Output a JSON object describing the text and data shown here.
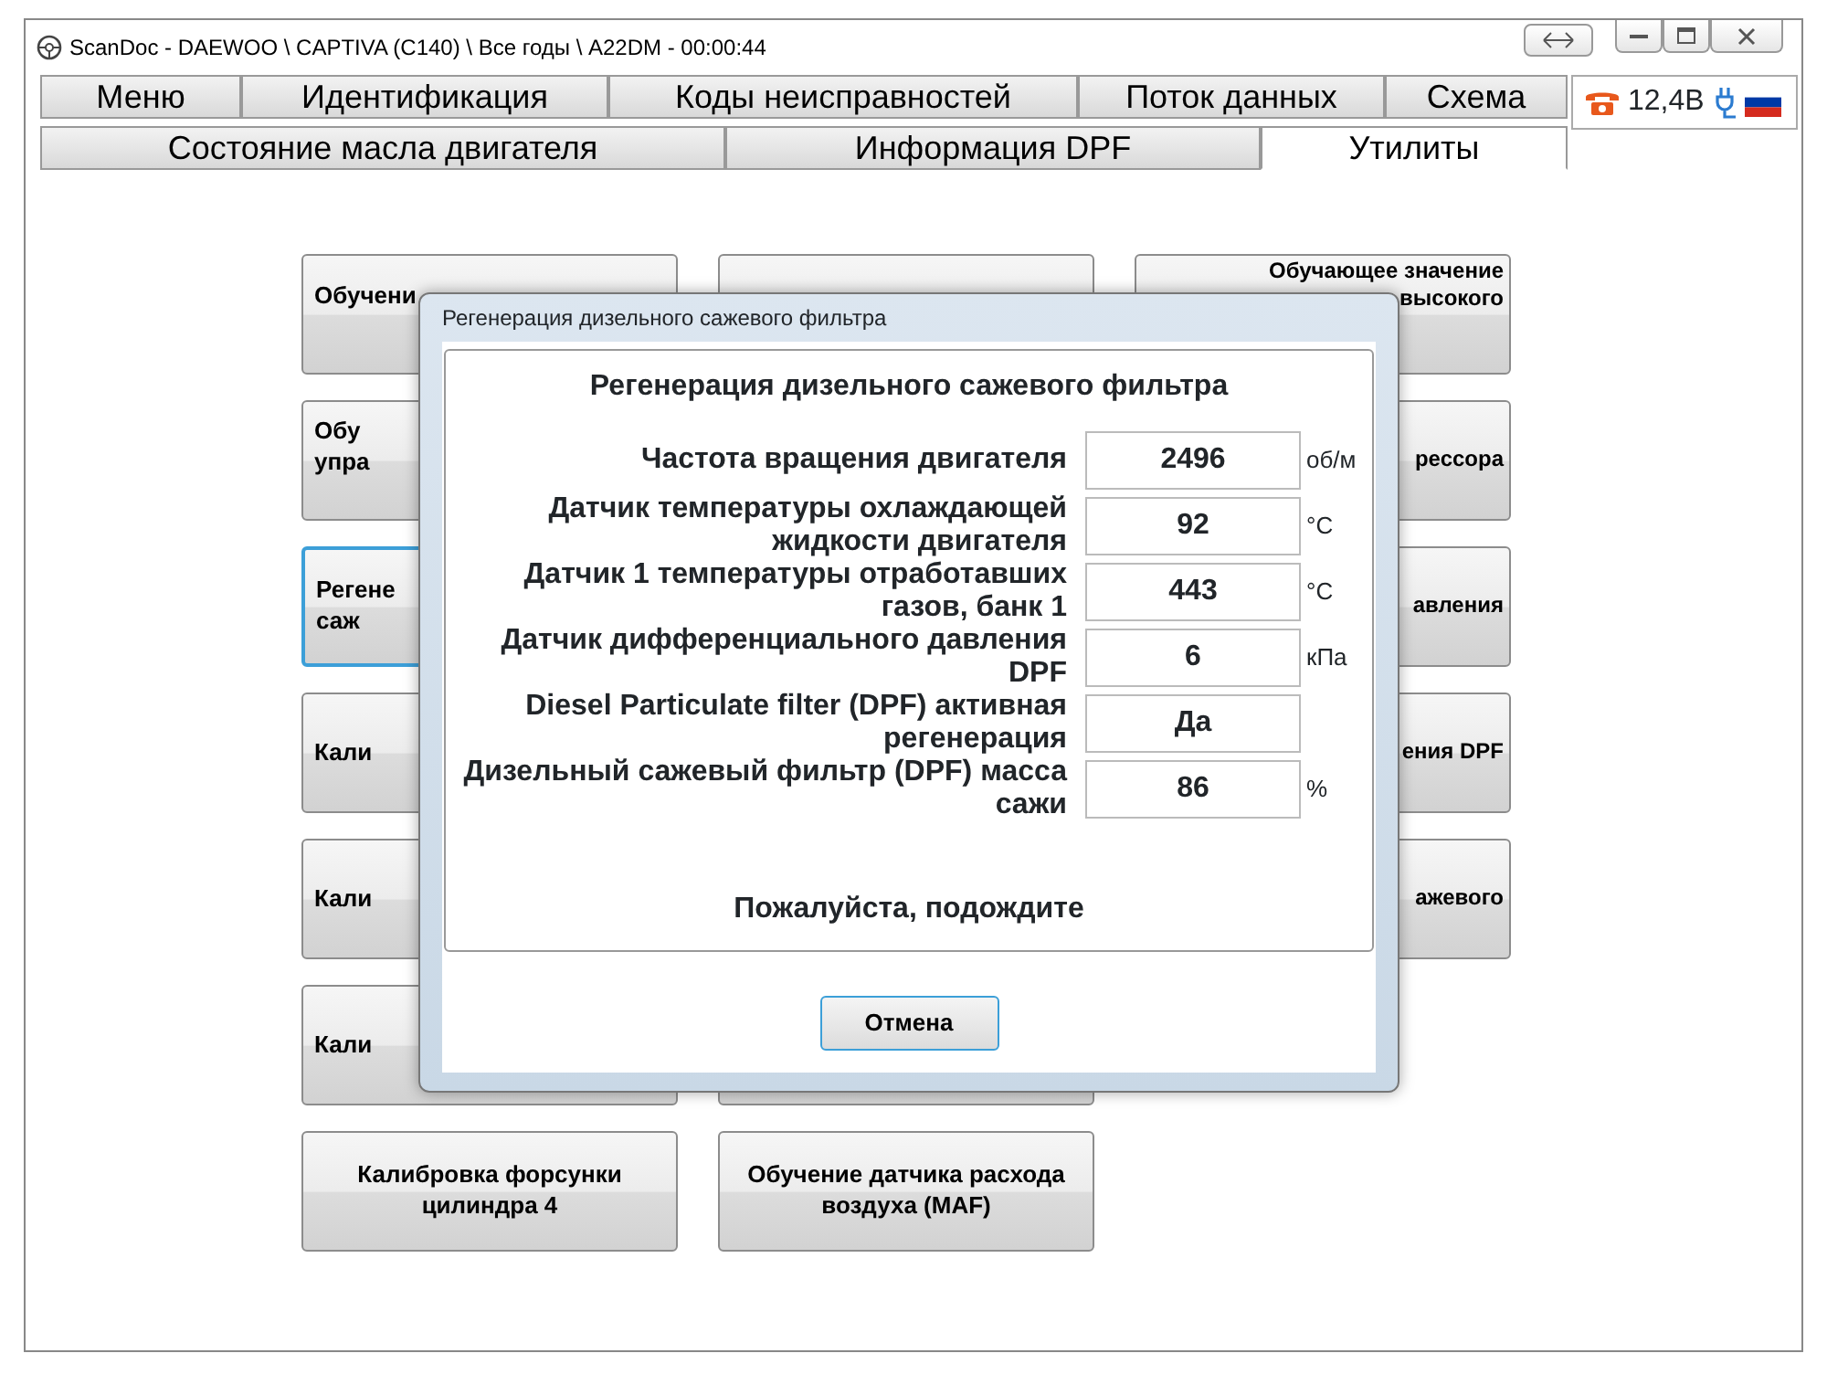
{
  "window": {
    "title": "ScanDoc - DAEWOO \\ CAPTIVA (C140) \\ Все годы \\ A22DM - 00:00:44"
  },
  "tabs_top": [
    {
      "label": "Меню",
      "selected": false
    },
    {
      "label": "Идентификация",
      "selected": false
    },
    {
      "label": "Коды неисправностей",
      "selected": false
    },
    {
      "label": "Поток данных",
      "selected": false
    },
    {
      "label": "Схема",
      "selected": false
    }
  ],
  "tabs_bottom": [
    {
      "label": "Состояние масла двигателя",
      "selected": false
    },
    {
      "label": "Информация DPF",
      "selected": false
    },
    {
      "label": "Утилиты",
      "selected": true
    }
  ],
  "status": {
    "voltage": "12,4В"
  },
  "columns": [
    [
      {
        "lines": [
          "Обучени"
        ],
        "selected": false
      },
      {
        "lines": [
          "Обу",
          "упра"
        ],
        "selected": false
      },
      {
        "lines": [
          "Регене",
          "саж"
        ],
        "selected": true
      },
      {
        "lines": [
          "Кали"
        ],
        "selected": false
      },
      {
        "lines": [
          "Кали"
        ],
        "selected": false
      },
      {
        "lines": [
          "Кали"
        ],
        "selected": false
      },
      {
        "lines": [
          "Калибровка форсунки",
          "цилиндра 4"
        ],
        "selected": false
      }
    ],
    [
      {
        "lines": [
          "Обучение датчика расхода",
          "воздуха (MAF)"
        ],
        "selected": false
      }
    ],
    [
      {
        "lines": [
          "Обучающее значение",
          "высокого"
        ],
        "selected": false
      },
      {
        "lines": [
          "рессора"
        ],
        "selected": false
      },
      {
        "lines": [
          "авления"
        ],
        "selected": false
      },
      {
        "lines": [
          "ения DPF"
        ],
        "selected": false
      },
      {
        "lines": [
          "ажевого"
        ],
        "selected": false
      }
    ]
  ],
  "dialog": {
    "title": "Регенерация дизельного сажевого фильтра",
    "heading": "Регенерация дизельного сажевого фильтра",
    "rows": [
      {
        "label": "Частота вращения двигателя",
        "value": "2496",
        "unit": "об/м"
      },
      {
        "label": "Датчик температуры охлаждающей жидкости двигателя",
        "value": "92",
        "unit": "°C"
      },
      {
        "label": "Датчик 1 температуры отработавших газов, банк 1",
        "value": "443",
        "unit": "°C"
      },
      {
        "label": "Датчик дифференциального давления DPF",
        "value": "6",
        "unit": "кПа"
      },
      {
        "label": "Diesel Particulate filter (DPF) активная регенерация",
        "value": "Да"
      },
      {
        "label": "Дизельный сажевый фильтр (DPF) масса сажи",
        "value": "86",
        "unit": "%"
      }
    ],
    "message": "Пожалуйста, подождите",
    "button": {
      "label": "Отмена"
    }
  }
}
